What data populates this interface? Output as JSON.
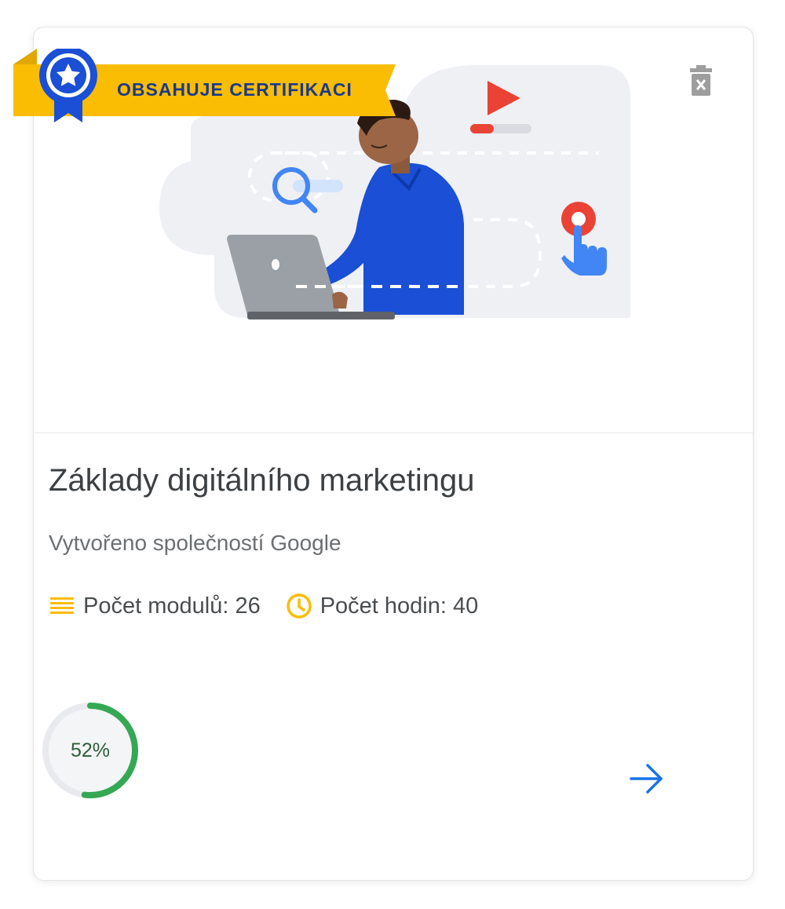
{
  "badge": {
    "label": "OBSAHUJE CERTIFIKACI",
    "icon": "award-ribbon-icon",
    "color": "#fbbc04"
  },
  "delete_icon": "trash-icon",
  "course": {
    "title": "Základy digitálního marketingu",
    "provider": "Vytvořeno společností Google",
    "modules_label": "Počet modulů: 26",
    "hours_label": "Počet hodin: 40"
  },
  "progress": {
    "value": 0.52,
    "label": "52%",
    "color": "#34a853"
  },
  "open_icon": "arrow-right-icon",
  "colors": {
    "accent_blue": "#1a73e8",
    "yellow": "#fbbc04",
    "red": "#ea4335",
    "green": "#34a853"
  }
}
